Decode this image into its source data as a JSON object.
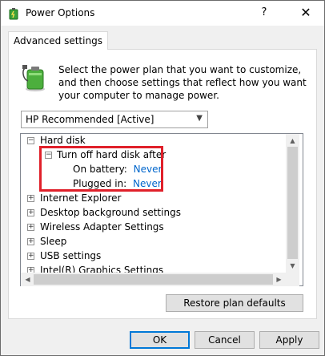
{
  "window": {
    "title": "Power Options",
    "help_label": "?",
    "close_label": "✕"
  },
  "tab": {
    "label": "Advanced settings"
  },
  "intro": {
    "text": "Select the power plan that you want to customize, and then choose settings that reflect how you want your computer to manage power."
  },
  "plan_select": {
    "value": "HP Recommended [Active]"
  },
  "tree": {
    "hard_disk": {
      "label": "Hard disk",
      "toggle": "−"
    },
    "turn_off": {
      "label": "Turn off hard disk after",
      "toggle": "−"
    },
    "on_battery": {
      "label": "On battery:",
      "value": "Never"
    },
    "plugged_in": {
      "label": "Plugged in:",
      "value": "Never"
    },
    "items": [
      {
        "label": "Internet Explorer",
        "toggle": "+"
      },
      {
        "label": "Desktop background settings",
        "toggle": "+"
      },
      {
        "label": "Wireless Adapter Settings",
        "toggle": "+"
      },
      {
        "label": "Sleep",
        "toggle": "+"
      },
      {
        "label": "USB settings",
        "toggle": "+"
      },
      {
        "label": "Intel(R) Graphics Settings",
        "toggle": "+"
      }
    ]
  },
  "buttons": {
    "restore": "Restore plan defaults",
    "ok": "OK",
    "cancel": "Cancel",
    "apply": "Apply"
  },
  "colors": {
    "highlight": "#e0202a",
    "link": "#0066cc",
    "accent": "#0078d7"
  }
}
